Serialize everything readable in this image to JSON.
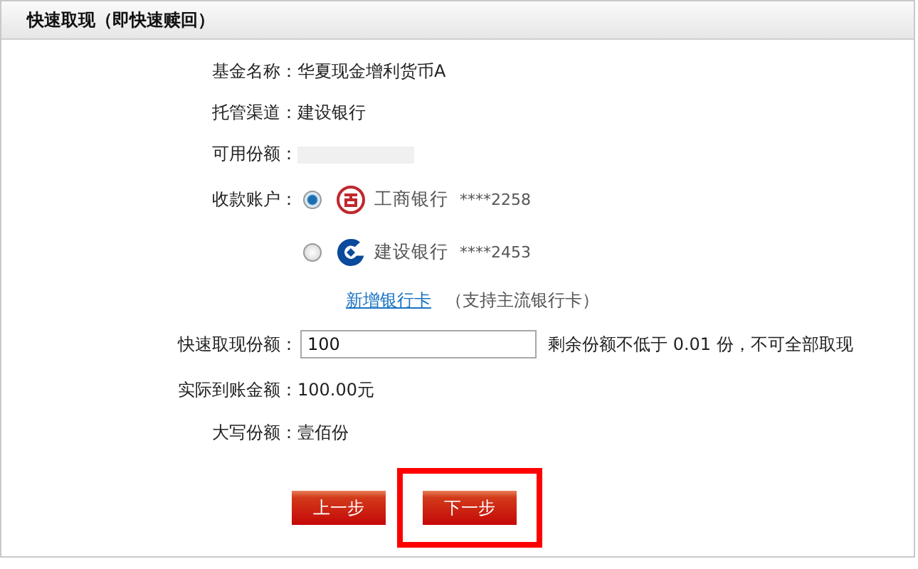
{
  "panel": {
    "title": "快速取现（即快速赎回）"
  },
  "info_rows": [
    {
      "kind": "text",
      "label": "基金名称：",
      "value": "华夏现金增利货币A"
    },
    {
      "kind": "text",
      "label": "托管渠道：",
      "value": "建设银行"
    },
    {
      "kind": "redacted",
      "label": "可用份额："
    }
  ],
  "account": {
    "label": "收款账户：",
    "options": [
      {
        "kind": "icbc",
        "bank": "工商银行",
        "number": "****2258",
        "selected": true
      },
      {
        "kind": "ccb",
        "bank": "建设银行",
        "number": "****2453",
        "selected": false
      }
    ],
    "add_link": "新增银行卡",
    "add_note": "（支持主流银行卡）"
  },
  "amount": {
    "label": "快速取现份额：",
    "value": "100",
    "hint": "剩余份额不低于 0.01 份，不可全部取现"
  },
  "result_rows": [
    {
      "label": "实际到账金额：",
      "value": "100.00元"
    },
    {
      "label": "大写份额：",
      "value": "壹佰份"
    }
  ],
  "buttons": [
    {
      "label": "上一步",
      "highlighted": false
    },
    {
      "label": "下一步",
      "highlighted": true
    }
  ]
}
